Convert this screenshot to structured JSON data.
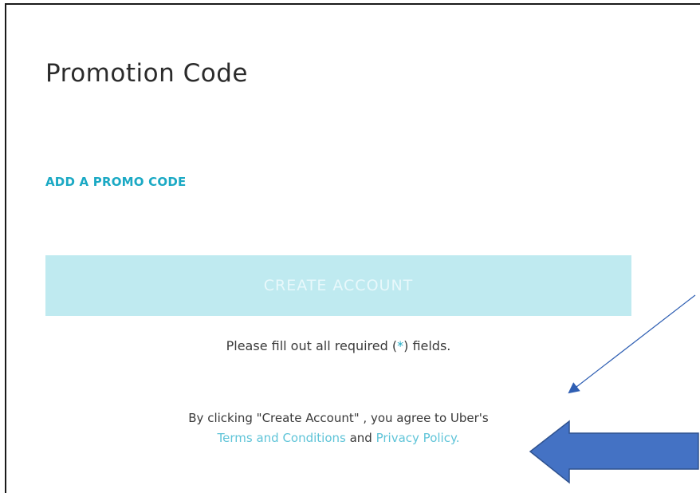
{
  "section": {
    "title": "Promotion Code",
    "promo_link": "ADD A PROMO CODE"
  },
  "form": {
    "create_button_label": "CREATE ACCOUNT",
    "required_prefix": "Please fill out all required (",
    "required_star": "*",
    "required_suffix": ") fields."
  },
  "legal": {
    "line1": "By clicking \"Create Account\" , you agree to Uber's",
    "terms_link": "Terms and Conditions",
    "and_text": " and ",
    "privacy_link": "Privacy Policy",
    "period": "."
  },
  "annotations": {
    "arrow_color": "#4472c4",
    "thin_arrow_color": "#2f5fb3"
  }
}
